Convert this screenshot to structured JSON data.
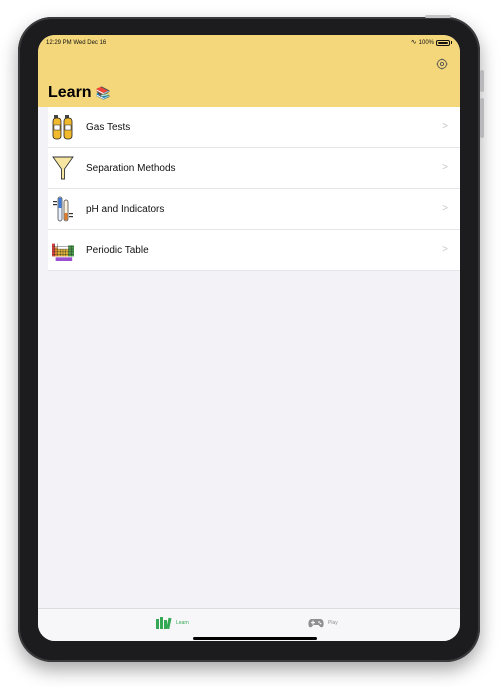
{
  "status_bar": {
    "time": "12:29 PM  Wed Dec 16",
    "battery": "100%"
  },
  "header": {
    "title": "Learn",
    "title_emoji": "📚"
  },
  "menu_items": [
    {
      "label": "Gas Tests",
      "icon": "gas-cylinders-icon"
    },
    {
      "label": "Separation Methods",
      "icon": "funnel-icon"
    },
    {
      "label": "pH and Indicators",
      "icon": "test-tubes-icon"
    },
    {
      "label": "Periodic Table",
      "icon": "periodic-table-icon"
    }
  ],
  "chevron": ">",
  "tabs": [
    {
      "label": "Learn",
      "icon": "books-icon",
      "active": true
    },
    {
      "label": "Play",
      "icon": "gamepad-icon",
      "active": false
    }
  ],
  "colors": {
    "header_bg": "#f4d77a",
    "active_tab": "#34a853",
    "inactive_tab": "#8e8e93"
  }
}
